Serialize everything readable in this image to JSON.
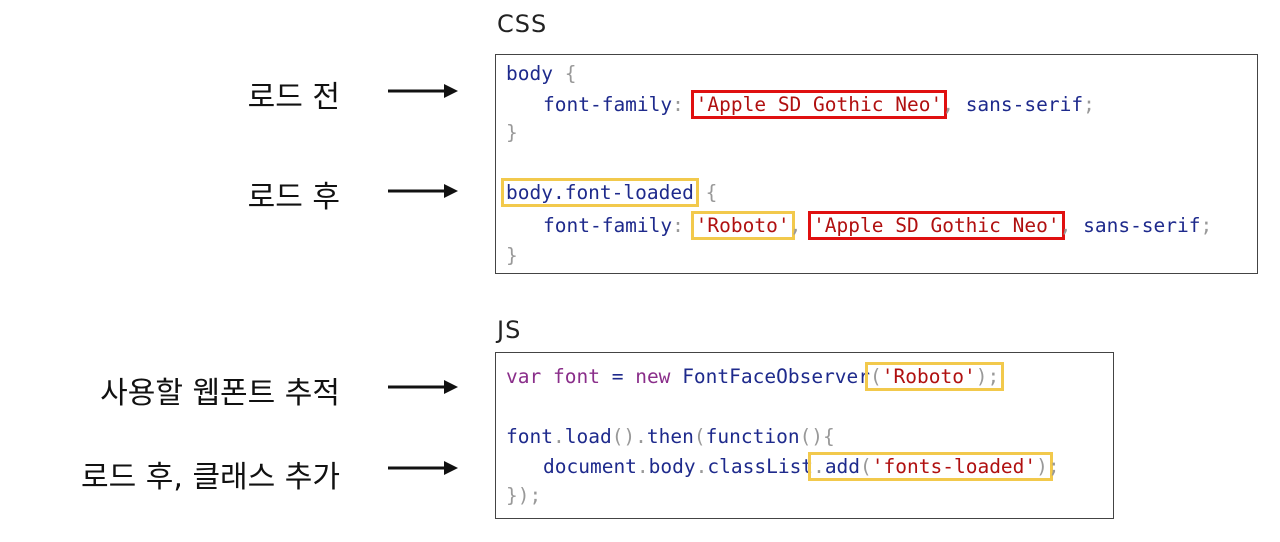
{
  "css_section": {
    "heading": "CSS",
    "labels": [
      "로드 전",
      "로드 후"
    ],
    "lines": {
      "l1_sel": "body",
      "l1_brace": "{",
      "l2_prop": "font-family",
      "l2_colon": ":",
      "l2_str": "'Apple SD Gothic Neo'",
      "l2_comma": ",",
      "l2_fallback": "sans-serif",
      "l2_semi": ";",
      "l3_close": "}",
      "l5_sel": "body.font-loaded",
      "l5_brace": "{",
      "l6_prop": "font-family",
      "l6_colon": ":",
      "l6_str1": "'Roboto'",
      "l6_comma1": ",",
      "l6_str2": "'Apple SD Gothic Neo'",
      "l6_comma2": ",",
      "l6_fallback": "sans-serif",
      "l6_semi": ";",
      "l7_close": "}"
    }
  },
  "js_section": {
    "heading": "JS",
    "labels": [
      "사용할 웹폰트 추적",
      "로드 후, 클래스 추가"
    ],
    "lines": {
      "l1_var": "var",
      "l1_name": "font",
      "l1_eq": "=",
      "l1_new": "new",
      "l1_ctor": "FontFaceObserver",
      "l1_args_open": "(",
      "l1_arg": "'Roboto'",
      "l1_args_close": ");",
      "l3_obj": "font",
      "l3_dot1": ".",
      "l3_load": "load",
      "l3_p1": "()",
      "l3_dot2": ".",
      "l3_then": "then",
      "l3_p2": "(",
      "l3_fn": "function",
      "l3_p3": "(){",
      "l4_doc": "document",
      "l4_dot1": ".",
      "l4_body": "body",
      "l4_dot2": ".",
      "l4_cl": "classList",
      "l4_dot3": ".",
      "l4_add": "add",
      "l4_p1": "(",
      "l4_str": "'fonts-loaded'",
      "l4_p2": ")",
      "l4_semi": ";",
      "l5_close": "});"
    }
  },
  "colors": {
    "red_highlight": "#e01010",
    "yellow_highlight": "#f2c94c"
  }
}
